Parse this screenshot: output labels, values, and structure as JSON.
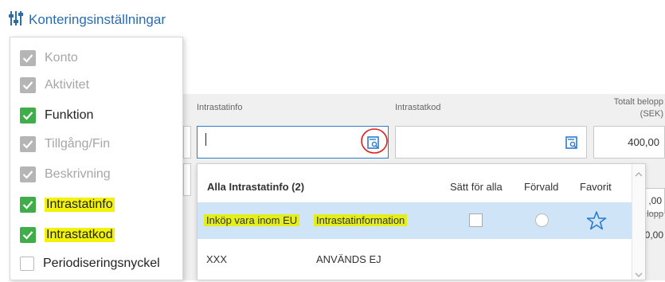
{
  "header": {
    "title": "Konteringsinställningar",
    "icon": "sliders-icon"
  },
  "settings_menu": {
    "items": [
      {
        "label": "Konto",
        "state": "disabled-checked"
      },
      {
        "label": "Aktivitet",
        "state": "disabled-checked"
      },
      {
        "label": "Funktion",
        "state": "checked"
      },
      {
        "label": "Tillgång/Fin",
        "state": "disabled-checked"
      },
      {
        "label": "Beskrivning",
        "state": "disabled-checked"
      },
      {
        "label": "Intrastatinfo",
        "state": "checked",
        "highlighted": true
      },
      {
        "label": "Intrastatkod",
        "state": "checked",
        "highlighted": true
      },
      {
        "label": "Periodiseringsnyckel",
        "state": "unchecked"
      }
    ]
  },
  "form": {
    "intrastatinfo_label": "Intrastatinfo",
    "intrastatkod_label": "Intrastatkod",
    "totalt_label_1": "Totalt belopp",
    "totalt_label_2": "(SEK)",
    "amount_1": "400,00",
    "amount_2": ",00",
    "amount_3_label": "lopp",
    "amount_3": "0,00"
  },
  "lookup_popup": {
    "header": "Alla Intrastatinfo (2)",
    "col_set_all": "Sätt för alla",
    "col_default": "Förvald",
    "col_favorite": "Favorit",
    "rows": [
      {
        "code": "Inköp vara inom EU",
        "name": "Intrastatinformation",
        "selected": true
      },
      {
        "code": "XXX",
        "name": "ANVÄNDS EJ",
        "selected": false
      }
    ]
  },
  "colors": {
    "accent": "#2b7bd0",
    "check_green": "#3fae4a",
    "highlight": "#f2f20a",
    "annotation": "#e0201b"
  }
}
